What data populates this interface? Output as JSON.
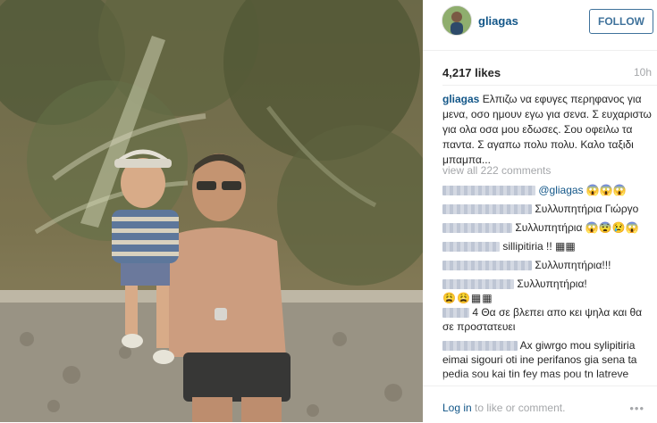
{
  "post": {
    "username": "gliagas",
    "follow_label": "FOLLOW",
    "likes": "4,217 likes",
    "time": "10h",
    "caption_text": "Ελπιζω να εφυγες περηφανος για μενα, οσο ημουν εγω για σενα. Σ ευχαριστω για ολα οσα μου εδωσες. Σου οφειλω τα παντα. Σ αγαπω πολυ πολυ. Καλο ταξιδι μπαμπα...",
    "view_all": "view all 222 comments"
  },
  "comments": [
    {
      "text": "@gliagas 😱😱😱"
    },
    {
      "text": "Συλλυπητήρια Γιώργο"
    },
    {
      "text": "Συλλυπητήρια 😱😨😢😱"
    },
    {
      "text": "sillipitiria !! ▦▦"
    },
    {
      "text": "Συλλυπητήρια!!!"
    },
    {
      "text": "Συλλυπητήρια!"
    },
    {
      "text": "😩😩▦▦"
    },
    {
      "text": "4 Θα σε βλεπει απο κει ψηλα και θα σε προστατευει"
    },
    {
      "text": "Ax giwrgo mou sylipitiria eimai sigouri oti ine perifanos gia sena ta pedia sou kai tin fey mas pou tn latreve"
    }
  ],
  "footer": {
    "login_link": "Log in",
    "login_rest": " to like or comment.",
    "more_dots": "•••"
  },
  "icons": {
    "more": "more-options-icon"
  },
  "colors": {
    "link": "#125688",
    "follow": "#3f729b",
    "muted": "#a5a7aa"
  }
}
